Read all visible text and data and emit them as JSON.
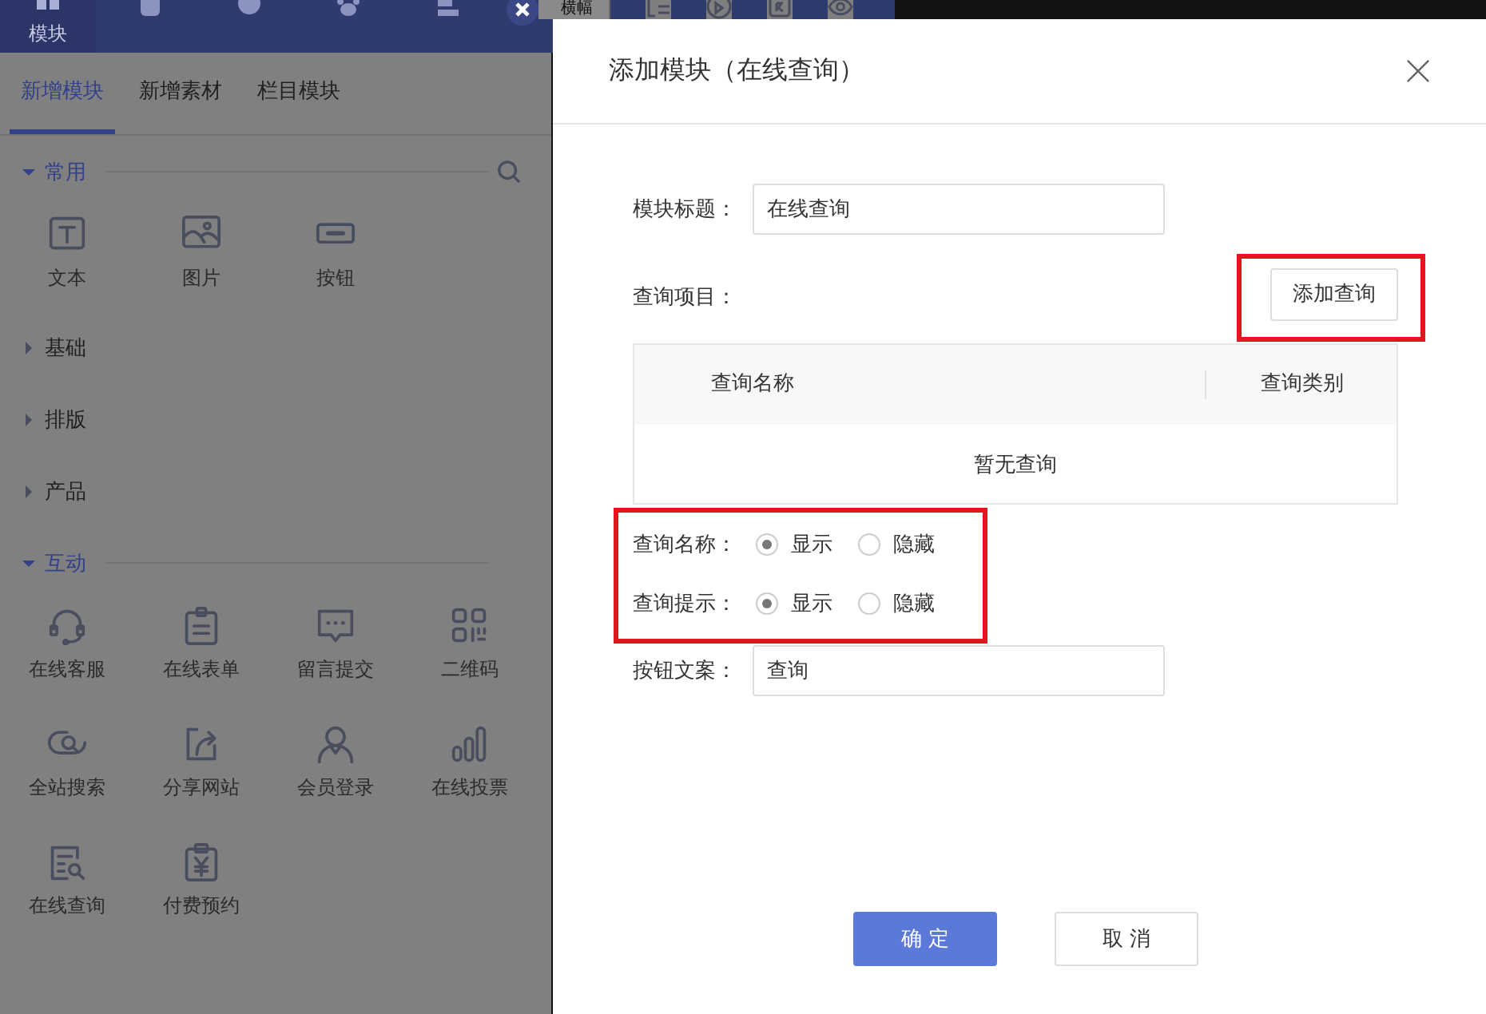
{
  "top_bar": {
    "tabs": [
      {
        "label": "模块",
        "selected": true
      }
    ],
    "cut_label": "横幅"
  },
  "side_panel": {
    "tabs": [
      {
        "label": "新增模块",
        "selected": true
      },
      {
        "label": "新增素材",
        "selected": false
      },
      {
        "label": "栏目模块",
        "selected": false
      }
    ],
    "groups": [
      {
        "title": "常用",
        "expanded": true,
        "items": [
          {
            "label": "文本"
          },
          {
            "label": "图片"
          },
          {
            "label": "按钮"
          }
        ]
      },
      {
        "title": "基础",
        "expanded": false
      },
      {
        "title": "排版",
        "expanded": false
      },
      {
        "title": "产品",
        "expanded": false
      },
      {
        "title": "互动",
        "expanded": true,
        "items": [
          {
            "label": "在线客服"
          },
          {
            "label": "在线表单"
          },
          {
            "label": "留言提交"
          },
          {
            "label": "二维码"
          },
          {
            "label": "全站搜索"
          },
          {
            "label": "分享网站"
          },
          {
            "label": "会员登录"
          },
          {
            "label": "在线投票"
          },
          {
            "label": "在线查询"
          },
          {
            "label": "付费预约"
          }
        ]
      }
    ]
  },
  "dialog": {
    "title": "添加模块（在线查询）",
    "title_field": {
      "label": "模块标题：",
      "value": "在线查询"
    },
    "query_items": {
      "label": "查询项目：",
      "add_button": "添加查询",
      "highlighted": true
    },
    "table": {
      "columns": [
        "查询名称",
        "查询类别"
      ],
      "empty_text": "暂无查询"
    },
    "radio_groups_highlighted": true,
    "radio_groups": [
      {
        "label": "查询名称：",
        "options": [
          {
            "label": "显示",
            "selected": true
          },
          {
            "label": "隐藏",
            "selected": false
          }
        ]
      },
      {
        "label": "查询提示：",
        "options": [
          {
            "label": "显示",
            "selected": true
          },
          {
            "label": "隐藏",
            "selected": false
          }
        ]
      }
    ],
    "button_text_field": {
      "label": "按钮文案：",
      "value": "查询"
    },
    "buttons": [
      {
        "label": "确 定",
        "kind": "primary"
      },
      {
        "label": "取 消",
        "kind": "default"
      }
    ]
  }
}
